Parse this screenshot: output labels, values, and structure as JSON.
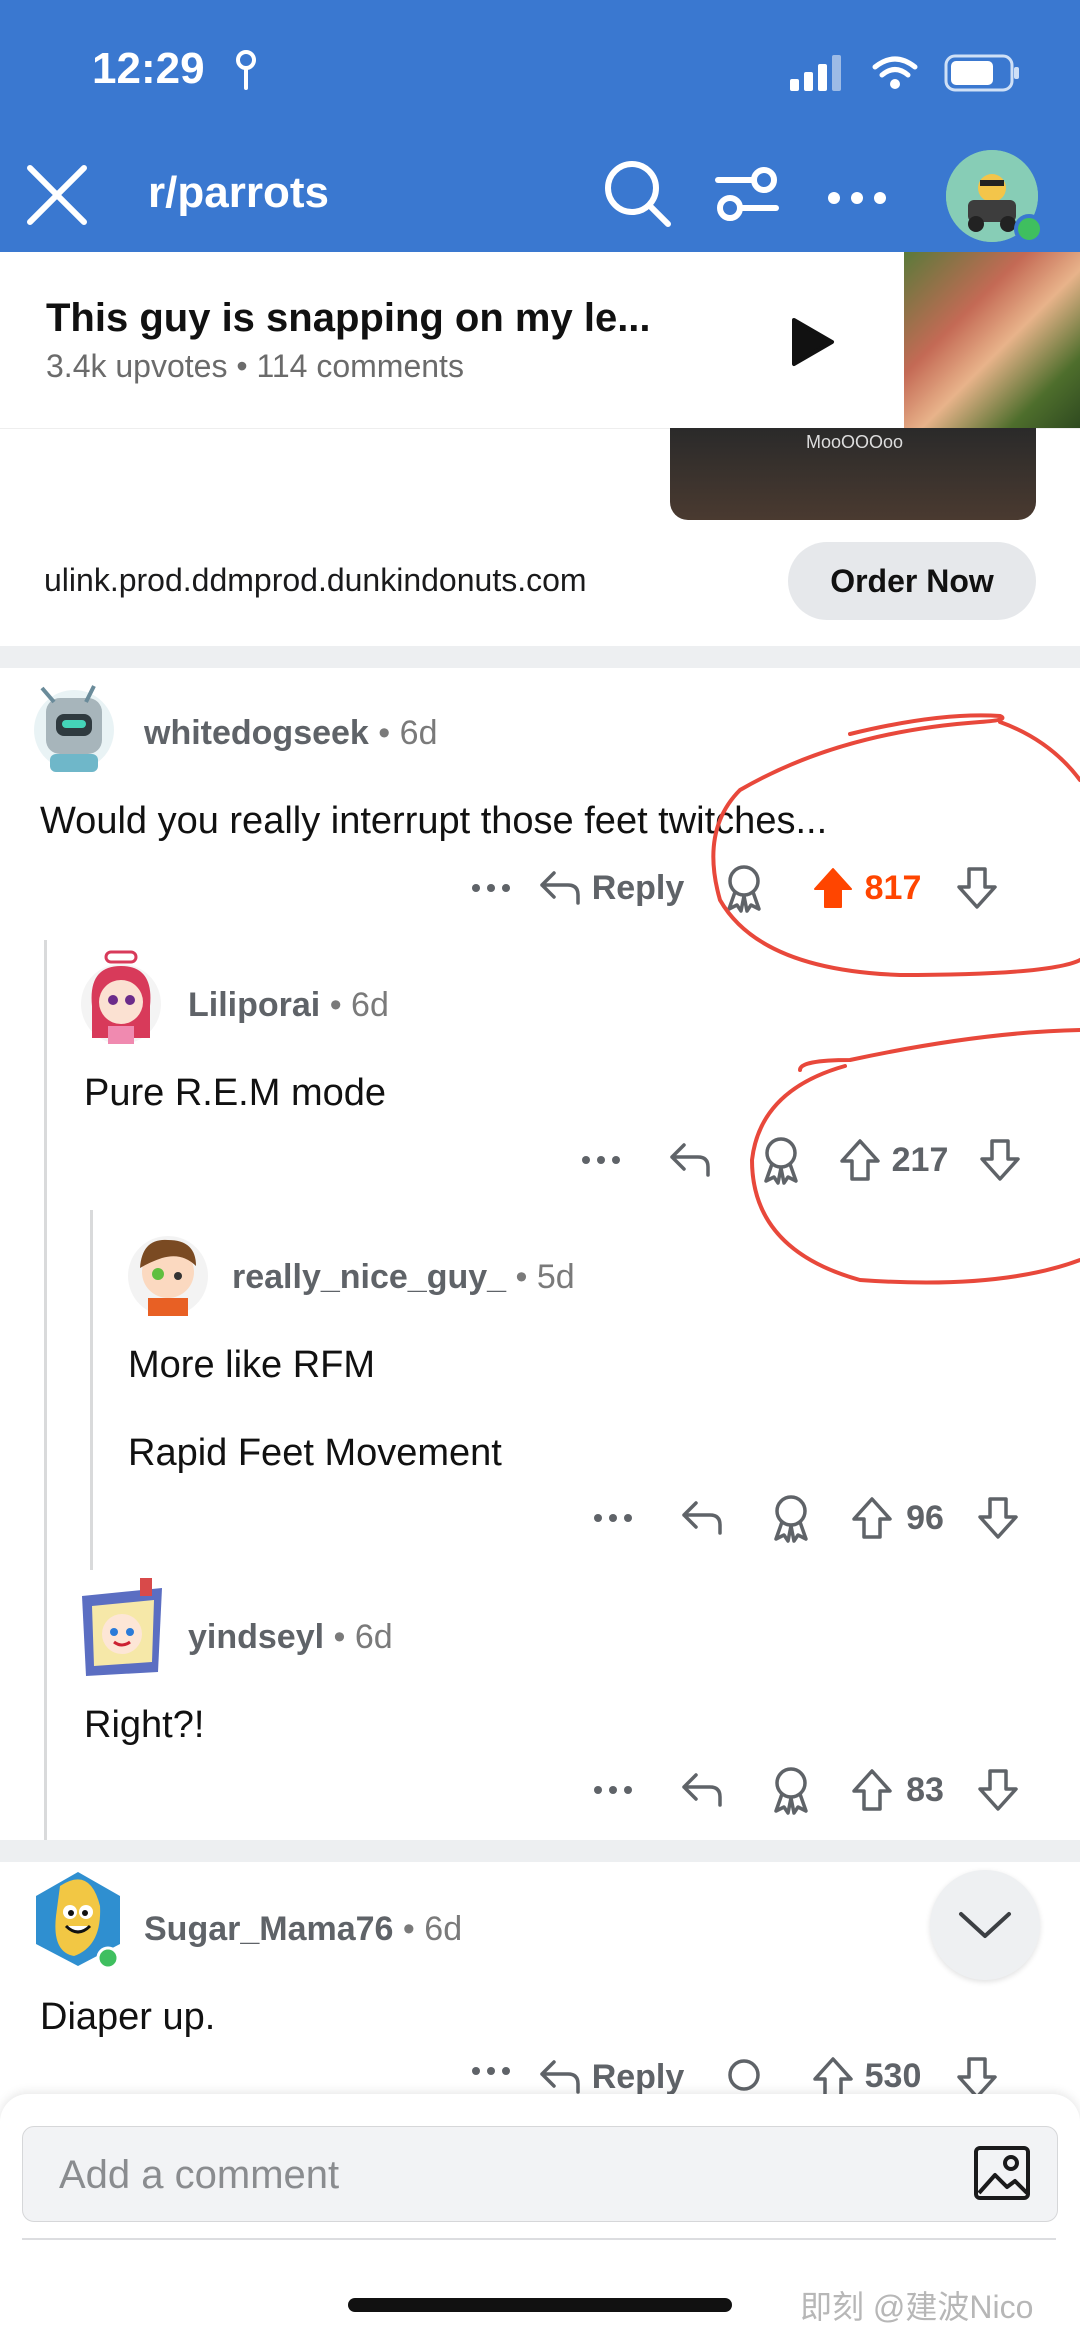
{
  "status": {
    "time": "12:29"
  },
  "header": {
    "subreddit": "r/parrots"
  },
  "pinned": {
    "title": "This guy is snapping on my le...",
    "upvotes": "3.4k upvotes",
    "comments": "114 comments"
  },
  "ad": {
    "image_caption": "MooOOOoo",
    "link": "ulink.prod.ddmprod.dunkindonuts.com",
    "cta": "Order Now"
  },
  "comments": [
    {
      "user": "whitedogseek",
      "age": "6d",
      "body": "Would you really interrupt those feet twitches...",
      "reply_label": "Reply",
      "score": "817"
    },
    {
      "user": "Liliporai",
      "age": "6d",
      "body": "Pure R.E.M mode",
      "score": "217"
    },
    {
      "user": "really_nice_guy_",
      "age": "5d",
      "body": "More like RFM",
      "body2": "Rapid Feet Movement",
      "score": "96"
    },
    {
      "user": "yindseyl",
      "age": "6d",
      "body": "Right?!",
      "score": "83"
    },
    {
      "user": "Sugar_Mama76",
      "age": "6d",
      "body": "Diaper up.",
      "reply_label": "Reply",
      "score": "530"
    }
  ],
  "composer": {
    "placeholder": "Add a comment"
  },
  "watermark": "即刻 @建波Nico",
  "sep": "•",
  "colors": {
    "header_bg": "#3a78d0",
    "upvote_active": "#ff4500",
    "annotation": "#e8483b"
  }
}
